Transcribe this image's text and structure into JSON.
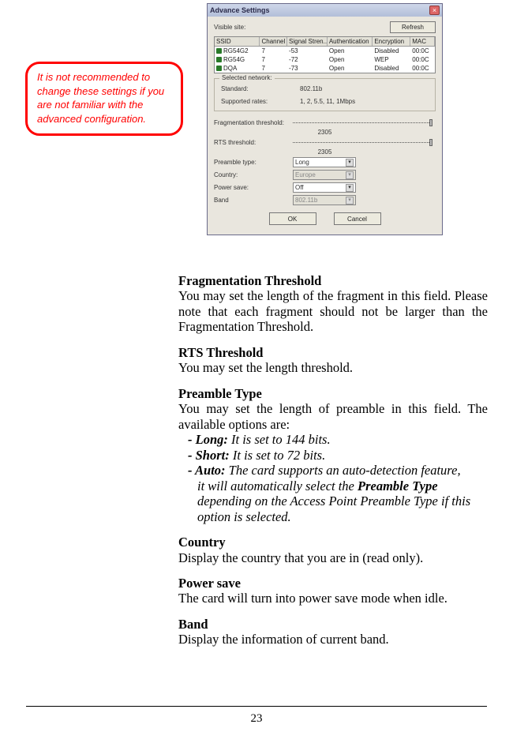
{
  "callout": {
    "text": "It is not recommended to change these settings if you are not familiar with the advanced configuration."
  },
  "dialog": {
    "title": "Advance Settings",
    "visible_site_label": "Visible site:",
    "refresh_label": "Refresh",
    "columns": {
      "ssid": "SSID",
      "channel": "Channel",
      "signal": "Signal Stren...",
      "auth": "Authentication",
      "enc": "Encryption",
      "mac": "MAC"
    },
    "rows": [
      {
        "ssid": "RG54G2",
        "channel": "7",
        "signal": "-53",
        "auth": "Open",
        "enc": "Disabled",
        "mac": "00:0C"
      },
      {
        "ssid": "RG54G",
        "channel": "7",
        "signal": "-72",
        "auth": "Open",
        "enc": "WEP",
        "mac": "00:0C"
      },
      {
        "ssid": "DQA",
        "channel": "7",
        "signal": "-73",
        "auth": "Open",
        "enc": "Disabled",
        "mac": "00:0C"
      }
    ],
    "selected_group": "Selected network:",
    "standard_label": "Standard:",
    "standard_value": "802.11b",
    "supported_label": "Supported rates:",
    "supported_value": "1, 2, 5.5, 11, 1Mbps",
    "frag_label": "Fragmentation threshold:",
    "frag_value": "2305",
    "rts_label": "RTS threshold:",
    "rts_value": "2305",
    "preamble_label": "Preamble type:",
    "preamble_value": "Long",
    "country_label": "Country:",
    "country_value": "Europe",
    "power_label": "Power save:",
    "power_value": "Off",
    "band_label": "Band",
    "band_value": "802.11b",
    "ok_label": "OK",
    "cancel_label": "Cancel"
  },
  "body": {
    "frag_h": "Fragmentation Threshold",
    "frag_p": "You may set the length of the fragment in this field. Please note that each fragment should not be larger than the Fragmentation Threshold.",
    "rts_h": "RTS Threshold",
    "rts_p": "You may set the length threshold.",
    "pre_h": "Preamble Type",
    "pre_p": "You may set the length of preamble in this field.  The available options are:",
    "pre_long_b": "- Long:",
    "pre_long_t": " It is set to 144 bits.",
    "pre_short_b": "- Short:",
    "pre_short_t": " It is set to 72 bits.",
    "pre_auto_b": "- Auto:",
    "pre_auto_t1": " The card supports an auto-detection feature,",
    "pre_auto_t2a": "it will automatically select the ",
    "pre_auto_t2b": "Preamble Type",
    "pre_auto_t3": "depending on the Access Point Preamble Type if this",
    "pre_auto_t4": "option is selected.",
    "country_h": "Country",
    "country_p": "Display the country that you are in (read only).",
    "power_h": "Power save",
    "power_p": "The card will turn into power save mode when idle.",
    "band_h": "Band",
    "band_p": "Display the information of current band."
  },
  "page_number": "23"
}
